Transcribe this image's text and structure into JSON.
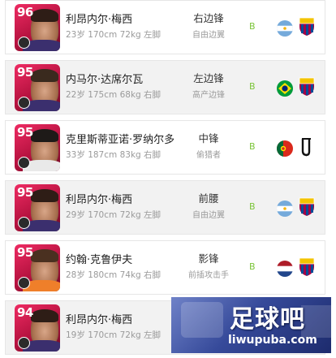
{
  "players": [
    {
      "rating": "96",
      "name": "利昂内尔·梅西",
      "meta": "23岁 170cm 72kg 左脚",
      "position": "右边锋",
      "style": "自由边翼",
      "grade": "B",
      "flag": "argentina-flag-icon",
      "club": "barcelona-crest-icon"
    },
    {
      "rating": "95",
      "name": "内马尔·达席尔瓦",
      "meta": "22岁 175cm 68kg 右脚",
      "position": "左边锋",
      "style": "高产边锋",
      "grade": "B",
      "flag": "brazil-flag-icon",
      "club": "barcelona-crest-icon"
    },
    {
      "rating": "95",
      "name": "克里斯蒂亚诺·罗纳尔多",
      "meta": "33岁 187cm 83kg 右脚",
      "position": "中锋",
      "style": "偷猎者",
      "grade": "B",
      "flag": "portugal-flag-icon",
      "club": "juventus-crest-icon"
    },
    {
      "rating": "95",
      "name": "利昂内尔·梅西",
      "meta": "29岁 170cm 72kg 左脚",
      "position": "前腰",
      "style": "自由边翼",
      "grade": "B",
      "flag": "argentina-flag-icon",
      "club": "barcelona-crest-icon"
    },
    {
      "rating": "95",
      "name": "约翰·克鲁伊夫",
      "meta": "28岁 180cm 74kg 右脚",
      "position": "影锋",
      "style": "前插攻击手",
      "grade": "B",
      "flag": "netherlands-flag-icon",
      "club": "barcelona-crest-icon"
    },
    {
      "rating": "94",
      "name": "利昂内尔·梅西",
      "meta": "19岁 170cm 72kg 左脚",
      "position": "",
      "style": "",
      "grade": "",
      "flag": "",
      "club": ""
    }
  ],
  "watermark": {
    "title": "足球吧",
    "url": "liwupuba.com"
  },
  "colors": {
    "card": "#d41a4c",
    "grade": "#7cc53a",
    "watermark": "#364a9a"
  }
}
